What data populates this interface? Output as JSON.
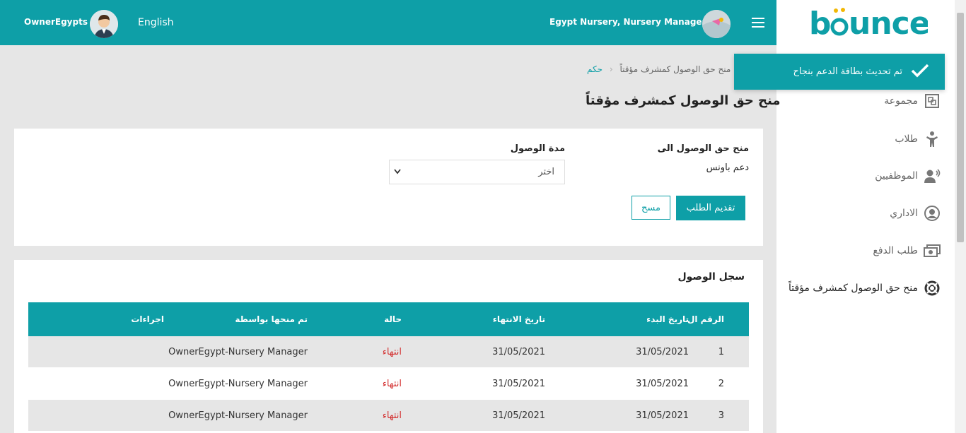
{
  "header": {
    "owner_name": "OwnerEgypts",
    "language": "English",
    "nursery_label": "Egypt Nursery, Nursery Manager"
  },
  "logo": {
    "text": "bounce",
    "brand_color": "#0e9fa7",
    "accent_color": "#f2b705"
  },
  "toast": {
    "message": "تم تحديث بطاقة الدعم بنجاح"
  },
  "breadcrumb": {
    "home": "حكم",
    "current": "منح حق الوصول كمشرف مؤقتاً"
  },
  "page_title": "منح حق الوصول كمشرف مؤقتاً",
  "sidebar": {
    "items": [
      {
        "label": "مجموعة",
        "icon": "group-icon"
      },
      {
        "label": "طلاب",
        "icon": "student-icon"
      },
      {
        "label": "الموظفيين",
        "icon": "staff-icon"
      },
      {
        "label": "الاداري",
        "icon": "admin-icon"
      },
      {
        "label": "طلب الدفع",
        "icon": "payment-icon"
      },
      {
        "label": "منح حق الوصول كمشرف مؤقتاً",
        "icon": "lifebuoy-icon"
      }
    ]
  },
  "form": {
    "access_to_label": "منح حق الوصول الى",
    "access_to_value": "دعم باونس",
    "duration_label": "مدة الوصول",
    "duration_selected": "اختر",
    "submit_label": "تقديم الطلب",
    "clear_label": "مسح"
  },
  "log": {
    "title": "سجل الوصول",
    "columns": {
      "number": "الرقم ال",
      "start_date": "تاريخ البدء",
      "end_date": "تاريخ الانتهاء",
      "status": "حالة",
      "granted_by": "تم منحها بواسطة",
      "actions": "اجراءات"
    },
    "rows": [
      {
        "number": "1",
        "start_date": "31/05/2021",
        "end_date": "31/05/2021",
        "status": "انتهاء",
        "granted_by": "OwnerEgypt-Nursery Manager"
      },
      {
        "number": "2",
        "start_date": "31/05/2021",
        "end_date": "31/05/2021",
        "status": "انتهاء",
        "granted_by": "OwnerEgypt-Nursery Manager"
      },
      {
        "number": "3",
        "start_date": "31/05/2021",
        "end_date": "31/05/2021",
        "status": "انتهاء",
        "granted_by": "OwnerEgypt-Nursery Manager"
      }
    ]
  },
  "colors": {
    "primary": "#0e9fa7",
    "status_expired": "#d32f2f",
    "row_alt": "#e6e6e6"
  }
}
